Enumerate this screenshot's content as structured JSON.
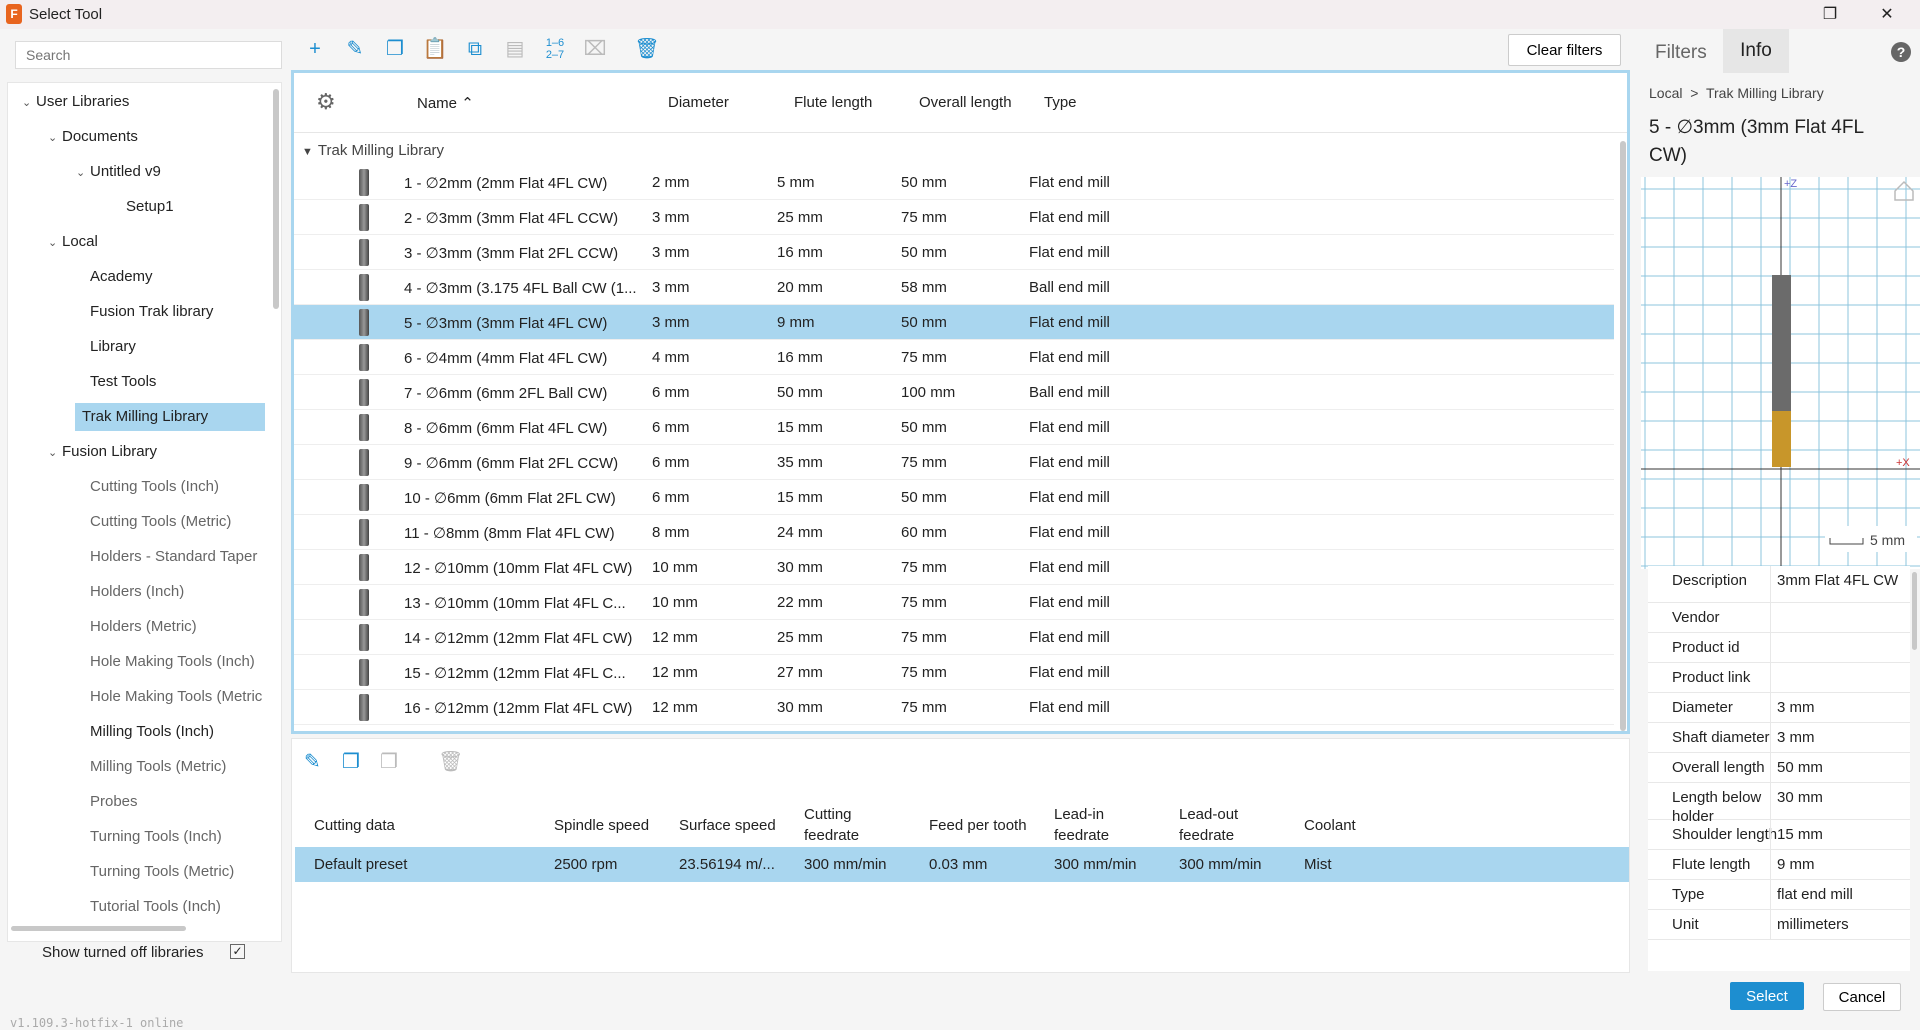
{
  "window": {
    "title": "Select Tool",
    "app_icon_letter": "F"
  },
  "left": {
    "search_placeholder": "Search",
    "tree": [
      {
        "label": "User Libraries",
        "level": 0,
        "caret": true,
        "gray": false
      },
      {
        "label": "Documents",
        "level": 1,
        "caret": true,
        "gray": false
      },
      {
        "label": "Untitled v9",
        "level": 2,
        "caret": true,
        "gray": false
      },
      {
        "label": "Setup1",
        "level": 3,
        "caret": false,
        "gray": false
      },
      {
        "label": "Local",
        "level": 1,
        "caret": true,
        "gray": false
      },
      {
        "label": "Academy",
        "level": 2,
        "caret": false,
        "gray": false
      },
      {
        "label": "Fusion Trak library",
        "level": 2,
        "caret": false,
        "gray": false
      },
      {
        "label": "Library",
        "level": 2,
        "caret": false,
        "gray": false
      },
      {
        "label": "Test Tools",
        "level": 2,
        "caret": false,
        "gray": false
      },
      {
        "label": "Trak Milling Library",
        "level": 2,
        "caret": false,
        "gray": false,
        "selected": true
      },
      {
        "label": "Fusion Library",
        "level": 1,
        "caret": true,
        "gray": false
      },
      {
        "label": "Cutting Tools (Inch)",
        "level": 2,
        "caret": false,
        "gray": true
      },
      {
        "label": "Cutting Tools (Metric)",
        "level": 2,
        "caret": false,
        "gray": true
      },
      {
        "label": "Holders - Standard Taper",
        "level": 2,
        "caret": false,
        "gray": true
      },
      {
        "label": "Holders (Inch)",
        "level": 2,
        "caret": false,
        "gray": true
      },
      {
        "label": "Holders (Metric)",
        "level": 2,
        "caret": false,
        "gray": true
      },
      {
        "label": "Hole Making Tools (Inch)",
        "level": 2,
        "caret": false,
        "gray": true
      },
      {
        "label": "Hole Making Tools (Metric",
        "level": 2,
        "caret": false,
        "gray": true
      },
      {
        "label": "Milling Tools (Inch)",
        "level": 2,
        "caret": false,
        "gray": false
      },
      {
        "label": "Milling Tools (Metric)",
        "level": 2,
        "caret": false,
        "gray": true
      },
      {
        "label": "Probes",
        "level": 2,
        "caret": false,
        "gray": true
      },
      {
        "label": "Turning Tools (Inch)",
        "level": 2,
        "caret": false,
        "gray": true
      },
      {
        "label": "Turning Tools (Metric)",
        "level": 2,
        "caret": false,
        "gray": true
      },
      {
        "label": "Tutorial Tools (Inch)",
        "level": 2,
        "caret": false,
        "gray": true
      }
    ],
    "show_turned_off": "Show turned off libraries",
    "show_turned_off_checked": true,
    "version": "v1.109.3-hotfix-1 online"
  },
  "toolbar": {
    "icons": [
      {
        "name": "add-icon",
        "glyph": "+",
        "enabled": true
      },
      {
        "name": "edit-icon",
        "glyph": "✎",
        "enabled": true
      },
      {
        "name": "copy-icon",
        "glyph": "❐",
        "enabled": true
      },
      {
        "name": "paste-icon",
        "glyph": "📋",
        "enabled": false
      },
      {
        "name": "duplicate-icon",
        "glyph": "⧉",
        "enabled": true
      },
      {
        "name": "print-icon",
        "glyph": "▤",
        "enabled": false
      },
      {
        "name": "renumber-icon",
        "glyph": "1–6",
        "enabled": true
      },
      {
        "name": "clean-icon",
        "glyph": "⌧",
        "enabled": false
      },
      {
        "name": "delete-icon",
        "glyph": "🗑",
        "enabled": true
      }
    ],
    "renumber_top": "1–6",
    "renumber_bottom": "2–7",
    "clear_filters": "Clear filters"
  },
  "grid": {
    "columns": [
      "Name",
      "Diameter",
      "Flute length",
      "Overall length",
      "Type"
    ],
    "sort_indicator": "^",
    "group": "Trak Milling Library",
    "rows": [
      [
        "1 - ∅2mm (2mm Flat 4FL CW)",
        "2 mm",
        "5 mm",
        "50 mm",
        "Flat end mill"
      ],
      [
        "2 - ∅3mm (3mm Flat 4FL CCW)",
        "3 mm",
        "25 mm",
        "75 mm",
        "Flat end mill"
      ],
      [
        "3 - ∅3mm (3mm Flat 2FL CCW)",
        "3 mm",
        "16 mm",
        "50 mm",
        "Flat end mill"
      ],
      [
        "4 - ∅3mm (3.175 4FL Ball CW (1...",
        "3 mm",
        "20 mm",
        "58 mm",
        "Ball end mill"
      ],
      [
        "5 - ∅3mm (3mm Flat 4FL CW)",
        "3 mm",
        "9 mm",
        "50 mm",
        "Flat end mill"
      ],
      [
        "6 - ∅4mm (4mm Flat 4FL CW)",
        "4 mm",
        "16 mm",
        "75 mm",
        "Flat end mill"
      ],
      [
        "7 - ∅6mm (6mm 2FL Ball CW)",
        "6 mm",
        "50 mm",
        "100 mm",
        "Ball end mill"
      ],
      [
        "8 - ∅6mm (6mm Flat 4FL CW)",
        "6 mm",
        "15 mm",
        "50 mm",
        "Flat end mill"
      ],
      [
        "9 - ∅6mm (6mm Flat 2FL CCW)",
        "6 mm",
        "35 mm",
        "75 mm",
        "Flat end mill"
      ],
      [
        "10 - ∅6mm (6mm Flat 2FL CW)",
        "6 mm",
        "15 mm",
        "50 mm",
        "Flat end mill"
      ],
      [
        "11 - ∅8mm (8mm Flat 4FL CW)",
        "8 mm",
        "24 mm",
        "60 mm",
        "Flat end mill"
      ],
      [
        "12 - ∅10mm (10mm Flat 4FL CW)",
        "10 mm",
        "30 mm",
        "75 mm",
        "Flat end mill"
      ],
      [
        "13 - ∅10mm (10mm Flat 4FL C...",
        "10 mm",
        "22 mm",
        "75 mm",
        "Flat end mill"
      ],
      [
        "14 - ∅12mm (12mm Flat 4FL CW)",
        "12 mm",
        "25 mm",
        "75 mm",
        "Flat end mill"
      ],
      [
        "15 - ∅12mm (12mm Flat 4FL C...",
        "12 mm",
        "27 mm",
        "75 mm",
        "Flat end mill"
      ],
      [
        "16 - ∅12mm (12mm Flat 4FL CW)",
        "12 mm",
        "30 mm",
        "75 mm",
        "Flat end mill"
      ]
    ],
    "selected_index": 4
  },
  "cutting": {
    "headers": [
      "Cutting data",
      "Spindle speed",
      "Surface speed",
      "Cutting feedrate",
      "Feed per tooth",
      "Lead-in feedrate",
      "Lead-out feedrate",
      "Coolant"
    ],
    "preset": [
      "Default preset",
      "2500 rpm",
      "23.56194 m/...",
      "300 mm/min",
      "0.03 mm",
      "300 mm/min",
      "300 mm/min",
      "Mist"
    ]
  },
  "right": {
    "tab_filters": "Filters",
    "tab_info": "Info",
    "crumb_root": "Local",
    "crumb_sep": ">",
    "crumb_leaf": "Trak Milling Library",
    "title": "5 - ∅3mm (3mm Flat 4FL CW)",
    "axis_z": "+Z",
    "axis_x": "+X",
    "scale": "5 mm",
    "props": [
      [
        "Description",
        "3mm Flat 4FL CW"
      ],
      [
        "Vendor",
        ""
      ],
      [
        "Product id",
        ""
      ],
      [
        "Product link",
        ""
      ],
      [
        "Diameter",
        "3 mm"
      ],
      [
        "Shaft diameter",
        "3 mm"
      ],
      [
        "Overall length",
        "50 mm"
      ],
      [
        "Length below holder",
        "30 mm"
      ],
      [
        "Shoulder length",
        "15 mm"
      ],
      [
        "Flute length",
        "9 mm"
      ],
      [
        "Type",
        "flat end mill"
      ],
      [
        "Unit",
        "millimeters"
      ]
    ]
  },
  "buttons": {
    "select": "Select",
    "cancel": "Cancel"
  },
  "colors": {
    "accent": "#1d8ed0",
    "selection": "#a9d6ef",
    "flute": "#c8962a",
    "shank": "#6b6b6b"
  }
}
